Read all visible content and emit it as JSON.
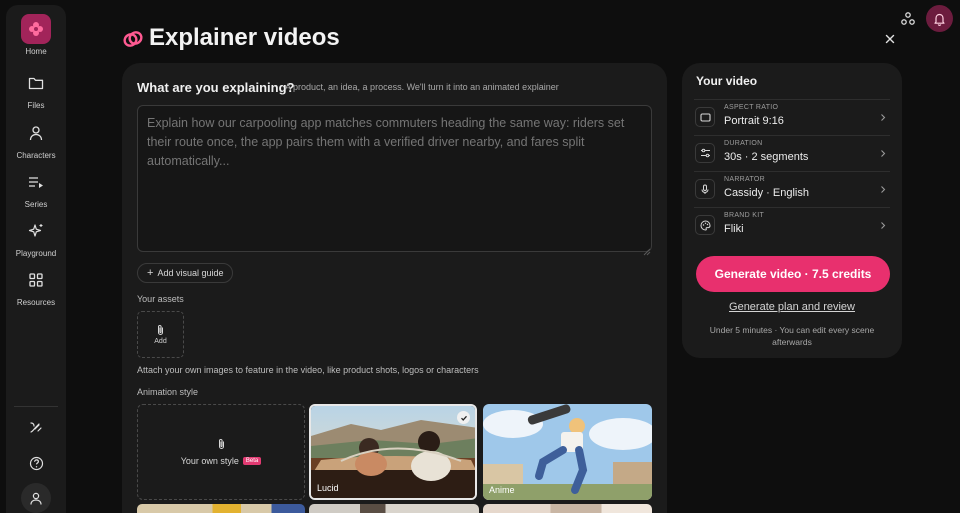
{
  "sidebar": {
    "items": [
      {
        "label": "Home",
        "icon": "flower-icon"
      },
      {
        "label": "Files",
        "icon": "folder-icon"
      },
      {
        "label": "Characters",
        "icon": "person-icon"
      },
      {
        "label": "Series",
        "icon": "playlist-icon"
      },
      {
        "label": "Playground",
        "icon": "sparkle-icon"
      },
      {
        "label": "Resources",
        "icon": "grid-icon"
      }
    ],
    "bottom_icons": [
      "brush-icon",
      "help-icon",
      "user-icon"
    ]
  },
  "header": {
    "title": "Explainer videos"
  },
  "main": {
    "question": "What are you explaining?",
    "question_hint": "A product, an idea, a process. We'll turn it into an animated explainer",
    "prompt_placeholder": "Explain how our carpooling app matches commuters heading the same way: riders set their route once, the app pairs them with a verified driver nearby, and fares split automatically...",
    "add_guide_label": "Add visual guide",
    "assets_label": "Your assets",
    "add_asset_label": "Add",
    "assets_hint": "Attach your own images to feature in the video, like product shots, logos or characters",
    "style_label": "Animation style",
    "styles": [
      {
        "label": "Your own style",
        "badge": "Beta"
      },
      {
        "label": "Lucid",
        "selected": true
      },
      {
        "label": "Anime"
      }
    ]
  },
  "side": {
    "title": "Your video",
    "settings": [
      {
        "key": "ASPECT RATIO",
        "value": "Portrait 9:16",
        "icon": "rectangle-icon"
      },
      {
        "key": "DURATION",
        "value": "30s · 2 segments",
        "icon": "sliders-icon"
      },
      {
        "key": "NARRATOR",
        "value": "Cassidy · English",
        "icon": "microphone-icon"
      },
      {
        "key": "BRAND KIT",
        "value": "Fliki",
        "icon": "palette-icon"
      }
    ],
    "generate_label": "Generate video · 7.5 credits",
    "plan_label": "Generate plan and review",
    "note": "Under 5 minutes · You can edit every scene afterwards"
  },
  "colors": {
    "accent": "#e8306e",
    "active_nav": "#a2245a",
    "panel": "#1b1b1b",
    "background": "#0e0e0e"
  }
}
